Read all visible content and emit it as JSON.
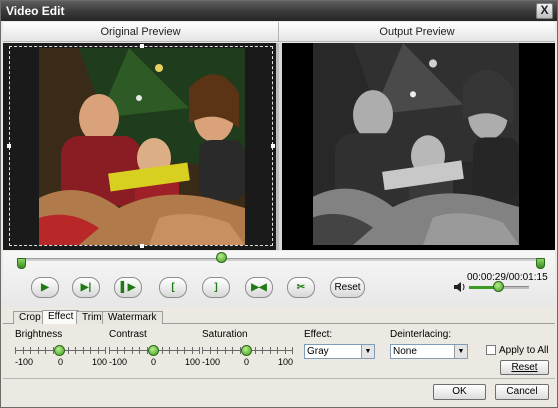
{
  "window": {
    "title": "Video Edit",
    "close_label": "X"
  },
  "preview": {
    "original_label": "Original Preview",
    "output_label": "Output Preview"
  },
  "playback": {
    "reset_label": "Reset",
    "time_display": "00:00:29/00:01:15",
    "position_fraction": 0.39,
    "volume_fraction": 0.5,
    "controls": [
      {
        "name": "play",
        "glyph": "▶"
      },
      {
        "name": "step-forward",
        "glyph": "▶|"
      },
      {
        "name": "next-frame",
        "glyph": "▌▶"
      },
      {
        "name": "mark-in",
        "glyph": "["
      },
      {
        "name": "mark-out",
        "glyph": "]"
      },
      {
        "name": "jump",
        "glyph": "▶◀"
      },
      {
        "name": "split",
        "glyph": "✂"
      }
    ]
  },
  "tabs": [
    "Crop",
    "Effect",
    "Trim",
    "Watermark"
  ],
  "active_tab": "Effect",
  "effect_panel": {
    "brightness": {
      "label": "Brightness",
      "min": "-100",
      "mid": "0",
      "max": "100",
      "value": 0
    },
    "contrast": {
      "label": "Contrast",
      "min": "-100",
      "mid": "0",
      "max": "100",
      "value": 0
    },
    "saturation": {
      "label": "Saturation",
      "min": "-100",
      "mid": "0",
      "max": "100",
      "value": 0
    },
    "effect": {
      "label": "Effect:",
      "selected": "Gray"
    },
    "deinterlacing": {
      "label": "Deinterlacing:",
      "selected": "None"
    },
    "apply_to_all_label": "Apply to All",
    "reset_label": "Reset"
  },
  "footer": {
    "ok_label": "OK",
    "cancel_label": "Cancel"
  },
  "colors": {
    "accent_green": "#3f9a23",
    "title_bar": "#3b3b3b"
  }
}
